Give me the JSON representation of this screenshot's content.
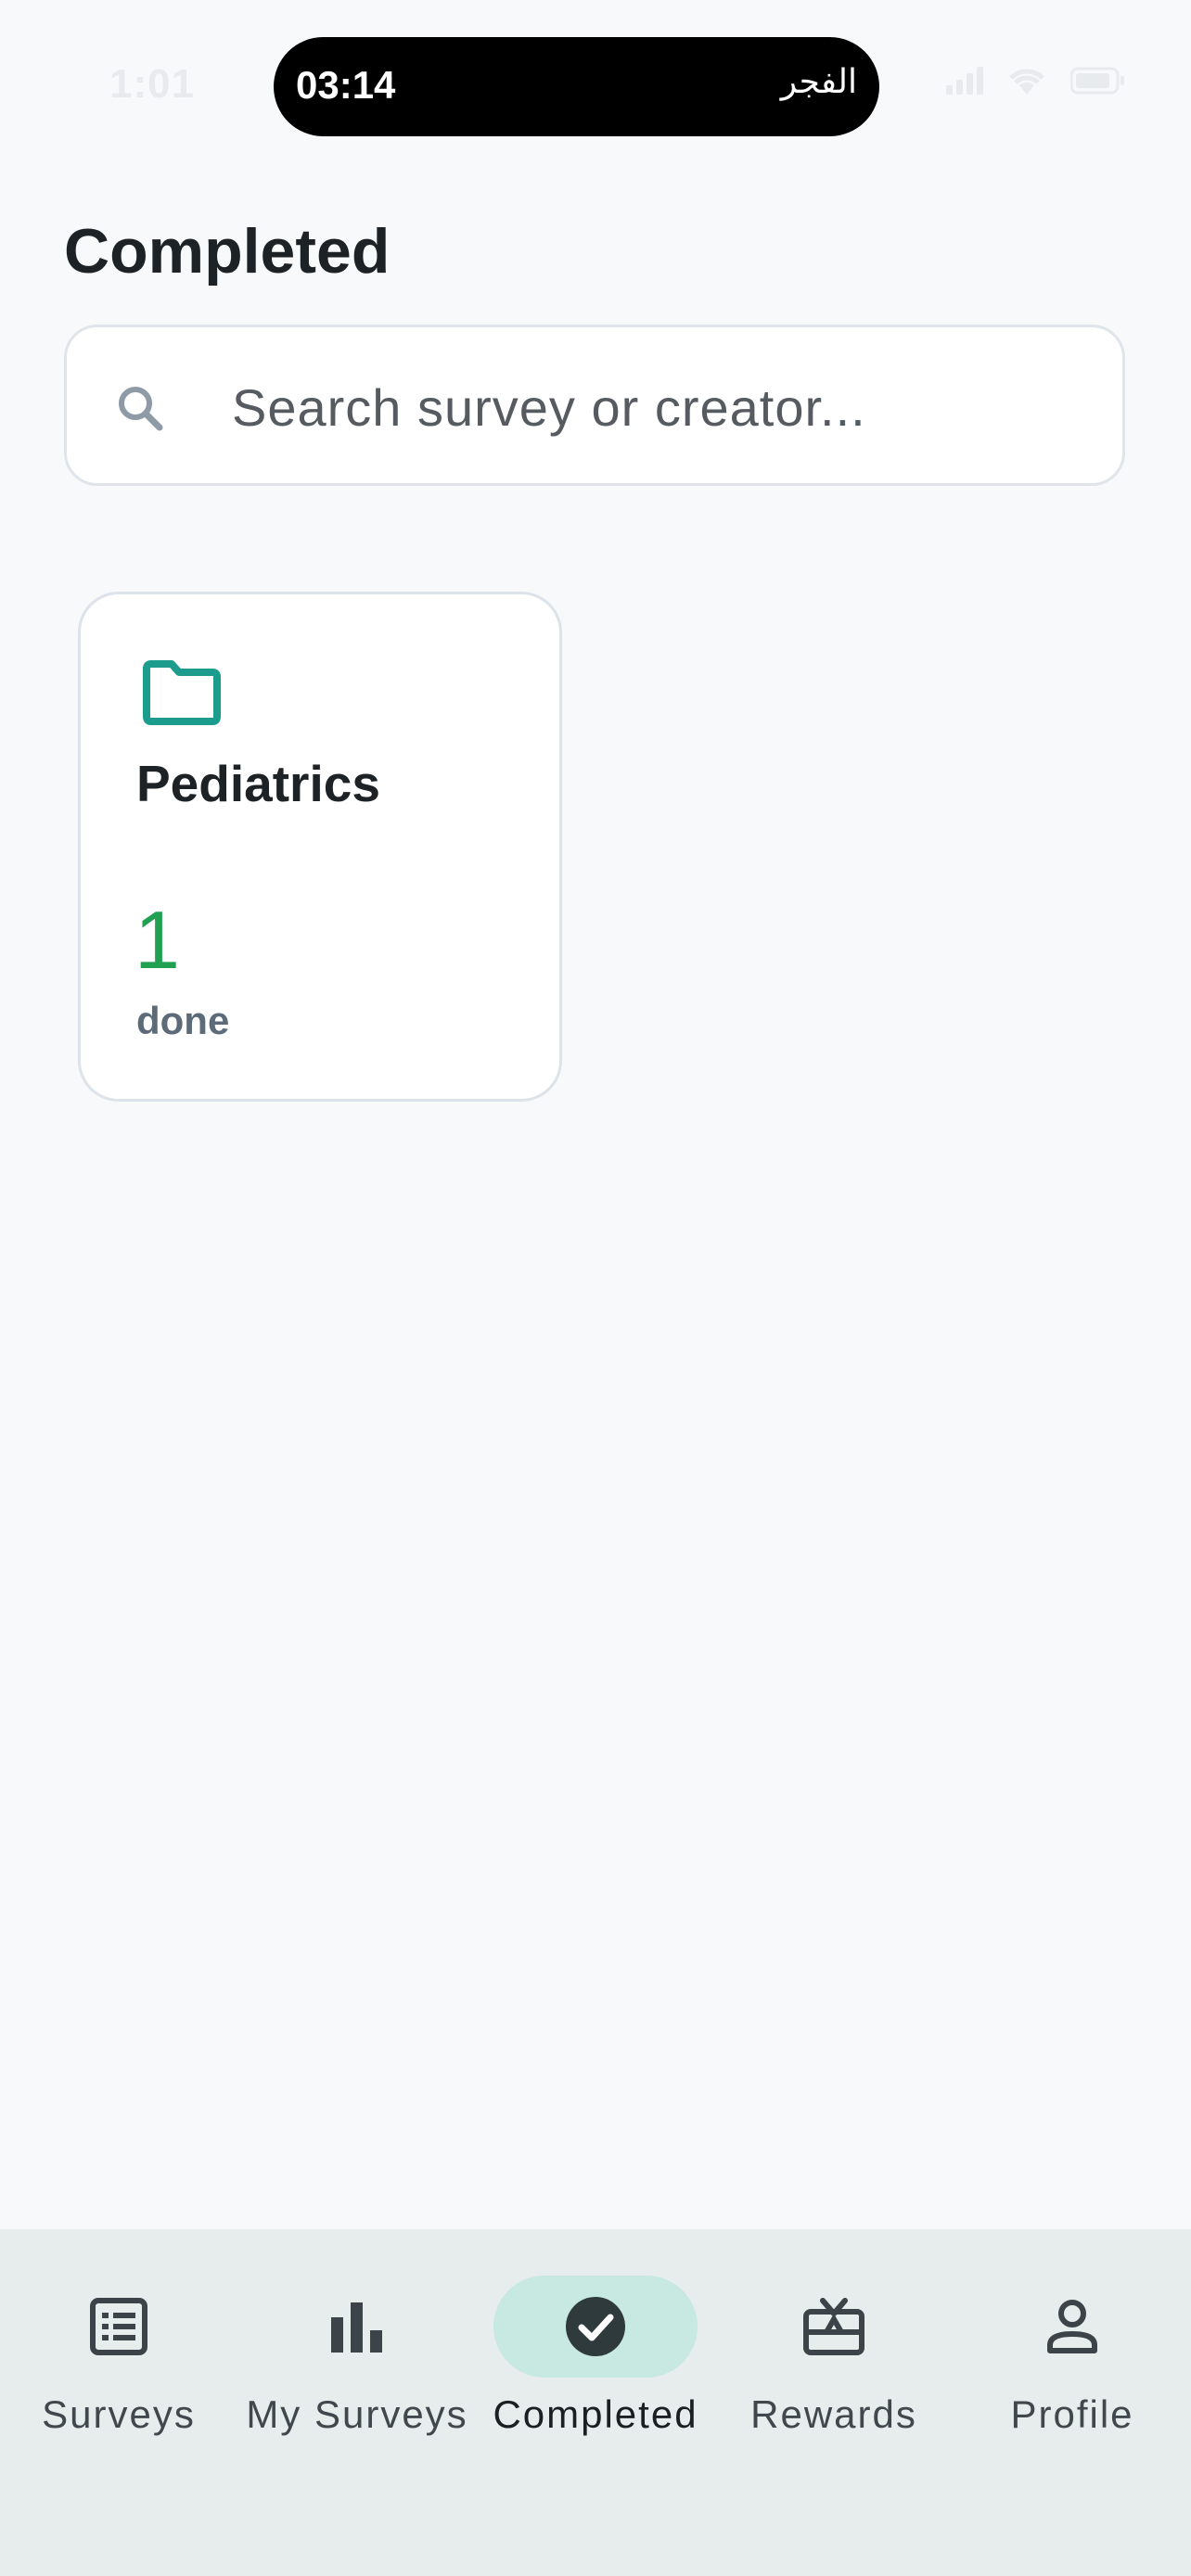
{
  "status_bar": {
    "time": "1:01",
    "activity_time": "03:14",
    "activity_label": "الفجر",
    "icons": [
      "signal-icon",
      "wifi-icon",
      "battery-icon"
    ]
  },
  "header": {
    "title": "Completed"
  },
  "search": {
    "placeholder": "Search survey or creator...",
    "value": "",
    "icon": "search-icon"
  },
  "categories": [
    {
      "icon": "folder-icon",
      "name": "Pediatrics",
      "count": "1",
      "count_label": "done"
    }
  ],
  "bottom_nav": {
    "active": "Completed",
    "items": [
      {
        "label": "Surveys",
        "icon": "list-icon"
      },
      {
        "label": "My Surveys",
        "icon": "bar-chart-icon"
      },
      {
        "label": "Completed",
        "icon": "check-circle-icon"
      },
      {
        "label": "Rewards",
        "icon": "gift-card-icon"
      },
      {
        "label": "Profile",
        "icon": "person-icon"
      }
    ]
  },
  "colors": {
    "accent": "#1b9c8c",
    "count_green": "#22a051",
    "active_nav_bg": "#c8e8e2",
    "nav_bg": "#e7edec",
    "page_bg": "#f7f9fb"
  }
}
